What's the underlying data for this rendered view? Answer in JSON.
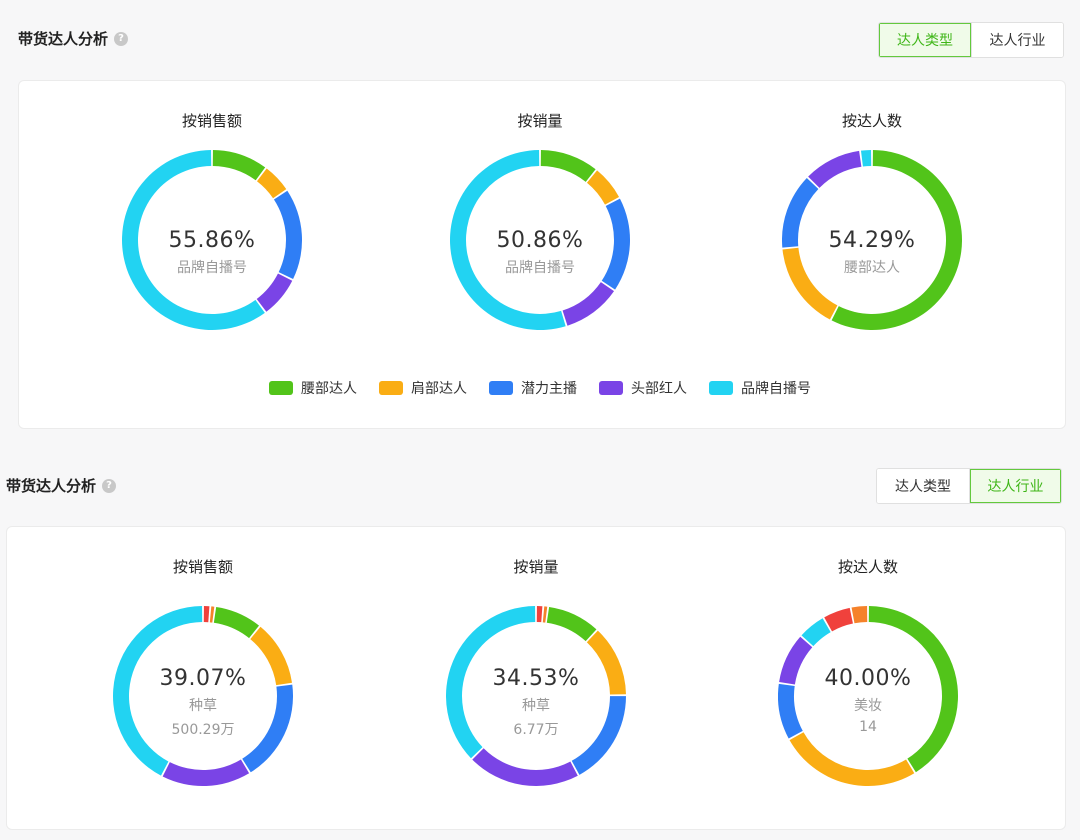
{
  "colors": {
    "accent_green": "#3fb618",
    "waist": "#52c41a",
    "shoulder": "#faad14",
    "potential": "#2f7ef5",
    "head": "#7a44e6",
    "brand": "#22d3f2",
    "red": "#f0413c",
    "orange": "#f5822a",
    "track": "#ffffff"
  },
  "section1": {
    "title": "带货达人分析",
    "help_icon": "?",
    "toggle": [
      "达人类型",
      "达人行业"
    ],
    "active_tab": 0
  },
  "section2": {
    "title": "带货达人分析",
    "help_icon": "?",
    "toggle": [
      "达人类型",
      "达人行业"
    ],
    "active_tab": 1
  },
  "legend": [
    {
      "label": "腰部达人",
      "color": "#52c41a"
    },
    {
      "label": "肩部达人",
      "color": "#faad14"
    },
    {
      "label": "潜力主播",
      "color": "#2f7ef5"
    },
    {
      "label": "头部红人",
      "color": "#7a44e6"
    },
    {
      "label": "品牌自播号",
      "color": "#22d3f2"
    }
  ],
  "chart_data": [
    {
      "type": "pie",
      "title": "按销售额",
      "center": {
        "pct": "55.86%",
        "label": "品牌自播号"
      },
      "series": [
        {
          "name": "腰部达人",
          "value": 9.5,
          "color": "#52c41a"
        },
        {
          "name": "肩部达人",
          "value": 5.0,
          "color": "#faad14"
        },
        {
          "name": "潜力主播",
          "value": 15.5,
          "color": "#2f7ef5"
        },
        {
          "name": "头部红人",
          "value": 7.0,
          "color": "#7a44e6"
        },
        {
          "name": "品牌自播号",
          "value": 55.86,
          "color": "#22d3f2"
        }
      ]
    },
    {
      "type": "pie",
      "title": "按销量",
      "center": {
        "pct": "50.86%",
        "label": "品牌自播号"
      },
      "series": [
        {
          "name": "腰部达人",
          "value": 10.0,
          "color": "#52c41a"
        },
        {
          "name": "肩部达人",
          "value": 6.0,
          "color": "#faad14"
        },
        {
          "name": "潜力主播",
          "value": 16.0,
          "color": "#2f7ef5"
        },
        {
          "name": "头部红人",
          "value": 10.0,
          "color": "#7a44e6"
        },
        {
          "name": "品牌自播号",
          "value": 50.86,
          "color": "#22d3f2"
        }
      ]
    },
    {
      "type": "pie",
      "title": "按达人数",
      "center": {
        "pct": "54.29%",
        "label": "腰部达人"
      },
      "series": [
        {
          "name": "腰部达人",
          "value": 54.29,
          "color": "#52c41a"
        },
        {
          "name": "肩部达人",
          "value": 15.0,
          "color": "#faad14"
        },
        {
          "name": "潜力主播",
          "value": 13.0,
          "color": "#2f7ef5"
        },
        {
          "name": "头部红人",
          "value": 10.0,
          "color": "#7a44e6"
        },
        {
          "name": "品牌自播号",
          "value": 2.0,
          "color": "#22d3f2"
        }
      ]
    },
    {
      "type": "pie",
      "title": "按销售额",
      "center": {
        "pct": "39.07%",
        "label": "种草",
        "value": "500.29万"
      },
      "series": [
        {
          "value": 1.2,
          "color": "#f0413c"
        },
        {
          "value": 0.8,
          "color": "#f5822a"
        },
        {
          "value": 8.0,
          "color": "#52c41a"
        },
        {
          "value": 11.0,
          "color": "#faad14"
        },
        {
          "value": 17.0,
          "color": "#2f7ef5"
        },
        {
          "value": 15.0,
          "color": "#7a44e6"
        },
        {
          "value": 39.07,
          "color": "#22d3f2"
        }
      ]
    },
    {
      "type": "pie",
      "title": "按销量",
      "center": {
        "pct": "34.53%",
        "label": "种草",
        "value": "6.77万"
      },
      "series": [
        {
          "value": 1.2,
          "color": "#f0413c"
        },
        {
          "value": 0.8,
          "color": "#f5822a"
        },
        {
          "value": 9.0,
          "color": "#52c41a"
        },
        {
          "value": 12.0,
          "color": "#faad14"
        },
        {
          "value": 16.0,
          "color": "#2f7ef5"
        },
        {
          "value": 19.0,
          "color": "#7a44e6"
        },
        {
          "value": 34.53,
          "color": "#22d3f2"
        }
      ]
    },
    {
      "type": "pie",
      "title": "按达人数",
      "center": {
        "pct": "40.00%",
        "label": "美妆",
        "value": "14"
      },
      "series": [
        {
          "value": 40.0,
          "color": "#52c41a"
        },
        {
          "value": 25.0,
          "color": "#faad14"
        },
        {
          "value": 10.0,
          "color": "#2f7ef5"
        },
        {
          "value": 9.0,
          "color": "#7a44e6"
        },
        {
          "value": 5.0,
          "color": "#22d3f2"
        },
        {
          "value": 5.0,
          "color": "#f0413c"
        },
        {
          "value": 3.0,
          "color": "#f5822a"
        }
      ]
    }
  ]
}
